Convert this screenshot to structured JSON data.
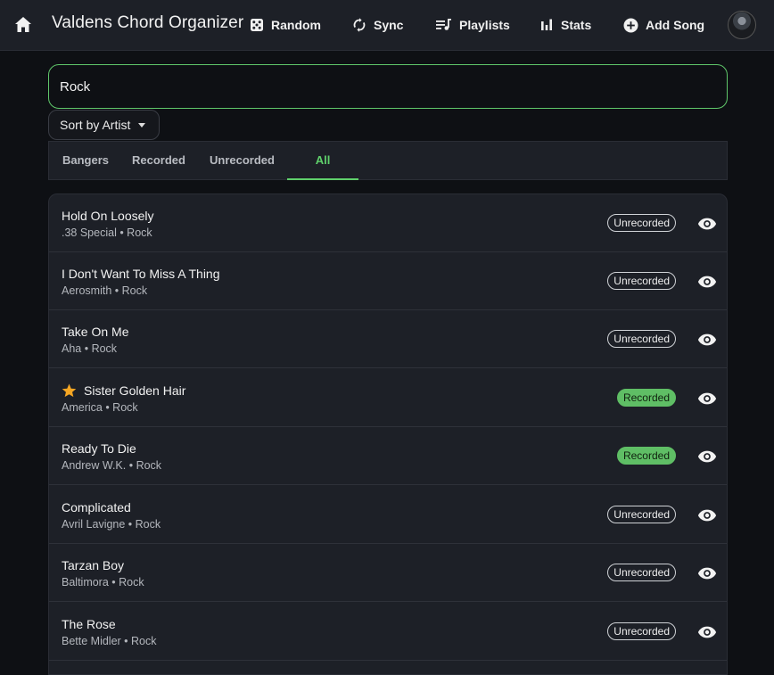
{
  "app": {
    "title": "Valdens Chord Organizer"
  },
  "nav": {
    "random": "Random",
    "sync": "Sync",
    "playlists": "Playlists",
    "stats": "Stats",
    "add_song": "Add Song"
  },
  "search": {
    "value": "Rock"
  },
  "sort": {
    "label": "Sort by Artist"
  },
  "tabs": [
    "Bangers",
    "Recorded",
    "Unrecorded",
    "All"
  ],
  "active_tab": "All",
  "colors": {
    "accent": "#5fd06b",
    "star": "#f5a623",
    "recorded_badge": "#5fbe65"
  },
  "songs": [
    {
      "title": "Hold On Loosely",
      "artist": ".38 Special",
      "genre": "Rock",
      "sub": ".38 Special • Rock",
      "status": "Unrecorded",
      "starred": false
    },
    {
      "title": "I Don't Want To Miss A Thing",
      "artist": "Aerosmith",
      "genre": "Rock",
      "sub": "Aerosmith • Rock",
      "status": "Unrecorded",
      "starred": false
    },
    {
      "title": "Take On Me",
      "artist": "Aha",
      "genre": "Rock",
      "sub": "Aha • Rock",
      "status": "Unrecorded",
      "starred": false
    },
    {
      "title": "Sister Golden Hair",
      "artist": "America",
      "genre": "Rock",
      "sub": "America • Rock",
      "status": "Recorded",
      "starred": true
    },
    {
      "title": "Ready To Die",
      "artist": "Andrew W.K.",
      "genre": "Rock",
      "sub": "Andrew W.K. • Rock",
      "status": "Recorded",
      "starred": false
    },
    {
      "title": "Complicated",
      "artist": "Avril Lavigne",
      "genre": "Rock",
      "sub": "Avril Lavigne • Rock",
      "status": "Unrecorded",
      "starred": false
    },
    {
      "title": "Tarzan Boy",
      "artist": "Baltimora",
      "genre": "Rock",
      "sub": "Baltimora • Rock",
      "status": "Unrecorded",
      "starred": false
    },
    {
      "title": "The Rose",
      "artist": "Bette Midler",
      "genre": "Rock",
      "sub": "Bette Midler • Rock",
      "status": "Unrecorded",
      "starred": false
    }
  ]
}
